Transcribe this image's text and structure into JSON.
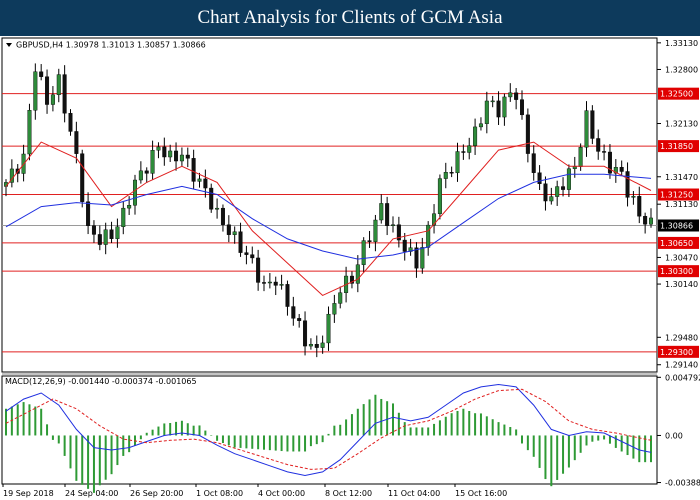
{
  "banner": {
    "title": "Chart Analysis for Clients of GCM Asia"
  },
  "chart_data": [
    {
      "type": "candlestick",
      "title": "GBPUSD,H4  1.30978 1.31013 1.30857 1.30866",
      "symbol": "GBPUSD",
      "timeframe": "H4",
      "quote": {
        "open": 1.30978,
        "high": 1.31013,
        "low": 1.30857,
        "close": 1.30866
      },
      "price_axis": {
        "ylim": [
          1.2905,
          1.3319
        ],
        "tick_labels": [
          "1.33130",
          "1.32800",
          "1.32130",
          "1.31470",
          "1.31130",
          "1.30470",
          "1.30140",
          "1.29480",
          "1.29140"
        ],
        "tick_values": [
          1.3313,
          1.328,
          1.3213,
          1.3147,
          1.3113,
          1.3047,
          1.3014,
          1.2948,
          1.2914
        ]
      },
      "support_resistance": [
        {
          "label": "1.32500",
          "value": 1.325
        },
        {
          "label": "1.31850",
          "value": 1.3185
        },
        {
          "label": "1.31250",
          "value": 1.3125
        },
        {
          "label": "1.30650",
          "value": 1.3065
        },
        {
          "label": "1.30300",
          "value": 1.303
        },
        {
          "label": "1.29300",
          "value": 1.293
        }
      ],
      "current_price": {
        "label": "1.30866",
        "value": 1.30866
      },
      "x_tick_labels": [
        "19 Sep 2018",
        "24 Sep 04:00",
        "26 Sep 20:00",
        "1 Oct 08:00",
        "4 Oct 00:00",
        "8 Oct 12:00",
        "11 Oct 04:00",
        "15 Oct 16:00"
      ],
      "close_path": [
        [
          0,
          1.314
        ],
        [
          3,
          1.317
        ],
        [
          5,
          1.3285
        ],
        [
          7,
          1.324
        ],
        [
          9,
          1.3265
        ],
        [
          12,
          1.317
        ],
        [
          14,
          1.308
        ],
        [
          16,
          1.307
        ],
        [
          18,
          1.3075
        ],
        [
          20,
          1.31
        ],
        [
          22,
          1.314
        ],
        [
          24,
          1.316
        ],
        [
          26,
          1.3185
        ],
        [
          28,
          1.317
        ],
        [
          30,
          1.3175
        ],
        [
          32,
          1.315
        ],
        [
          34,
          1.313
        ],
        [
          36,
          1.31
        ],
        [
          38,
          1.308
        ],
        [
          40,
          1.306
        ],
        [
          42,
          1.304
        ],
        [
          44,
          1.301
        ],
        [
          46,
          1.302
        ],
        [
          48,
          1.299
        ],
        [
          50,
          1.296
        ],
        [
          51,
          1.2945
        ],
        [
          53,
          1.293
        ],
        [
          55,
          1.297
        ],
        [
          57,
          1.301
        ],
        [
          59,
          1.302
        ],
        [
          61,
          1.306
        ],
        [
          63,
          1.309
        ],
        [
          64,
          1.311
        ],
        [
          66,
          1.308
        ],
        [
          68,
          1.306
        ],
        [
          70,
          1.304
        ],
        [
          72,
          1.308
        ],
        [
          74,
          1.314
        ],
        [
          76,
          1.316
        ],
        [
          78,
          1.318
        ],
        [
          80,
          1.32
        ],
        [
          82,
          1.324
        ],
        [
          84,
          1.323
        ],
        [
          86,
          1.325
        ],
        [
          87,
          1.325
        ],
        [
          89,
          1.318
        ],
        [
          91,
          1.313
        ],
        [
          93,
          1.312
        ],
        [
          95,
          1.314
        ],
        [
          97,
          1.316
        ],
        [
          99,
          1.322
        ],
        [
          101,
          1.318
        ],
        [
          103,
          1.316
        ],
        [
          105,
          1.315
        ],
        [
          106,
          1.313
        ],
        [
          108,
          1.31
        ],
        [
          110,
          1.3087
        ]
      ],
      "ma_fast": [
        [
          0,
          1.3135
        ],
        [
          6,
          1.319
        ],
        [
          12,
          1.317
        ],
        [
          18,
          1.311
        ],
        [
          24,
          1.314
        ],
        [
          30,
          1.316
        ],
        [
          36,
          1.314
        ],
        [
          42,
          1.308
        ],
        [
          48,
          1.304
        ],
        [
          54,
          1.3
        ],
        [
          60,
          1.302
        ],
        [
          66,
          1.307
        ],
        [
          72,
          1.308
        ],
        [
          78,
          1.313
        ],
        [
          84,
          1.318
        ],
        [
          90,
          1.319
        ],
        [
          96,
          1.316
        ],
        [
          102,
          1.316
        ],
        [
          110,
          1.313
        ]
      ],
      "ma_slow": [
        [
          0,
          1.3085
        ],
        [
          6,
          1.311
        ],
        [
          12,
          1.3115
        ],
        [
          18,
          1.3112
        ],
        [
          24,
          1.3125
        ],
        [
          30,
          1.3135
        ],
        [
          36,
          1.3125
        ],
        [
          42,
          1.3095
        ],
        [
          48,
          1.307
        ],
        [
          54,
          1.3055
        ],
        [
          60,
          1.3045
        ],
        [
          66,
          1.305
        ],
        [
          72,
          1.306
        ],
        [
          78,
          1.309
        ],
        [
          84,
          1.312
        ],
        [
          90,
          1.314
        ],
        [
          96,
          1.315
        ],
        [
          102,
          1.315
        ],
        [
          110,
          1.3145
        ]
      ]
    },
    {
      "type": "line",
      "title": "MACD(12,26,9) -0.001440 -0.000374 -0.001065",
      "indicator": "MACD(12,26,9)",
      "readout": {
        "main": -0.00144,
        "signal": -0.000374,
        "histogram": -0.001065
      },
      "ylim": [
        -0.004,
        0.0049
      ],
      "tick_labels": [
        "0.004792",
        "0.00",
        "-0.00388"
      ],
      "tick_values": [
        0.004792,
        0.0,
        -0.00388
      ],
      "main_line": [
        [
          0,
          0.002
        ],
        [
          3,
          0.003
        ],
        [
          6,
          0.0035
        ],
        [
          9,
          0.0025
        ],
        [
          12,
          0.0005
        ],
        [
          15,
          -0.001
        ],
        [
          18,
          -0.0012
        ],
        [
          21,
          -0.001
        ],
        [
          24,
          -0.0005
        ],
        [
          27,
          0.0
        ],
        [
          30,
          0.0002
        ],
        [
          33,
          0.0
        ],
        [
          36,
          -0.0008
        ],
        [
          39,
          -0.0015
        ],
        [
          42,
          -0.002
        ],
        [
          45,
          -0.0025
        ],
        [
          48,
          -0.003
        ],
        [
          51,
          -0.0033
        ],
        [
          54,
          -0.003
        ],
        [
          57,
          -0.002
        ],
        [
          60,
          -0.0005
        ],
        [
          63,
          0.001
        ],
        [
          66,
          0.0015
        ],
        [
          69,
          0.0012
        ],
        [
          72,
          0.0015
        ],
        [
          75,
          0.0025
        ],
        [
          78,
          0.0035
        ],
        [
          81,
          0.004
        ],
        [
          84,
          0.0042
        ],
        [
          87,
          0.004
        ],
        [
          90,
          0.0025
        ],
        [
          93,
          0.0005
        ],
        [
          96,
          0.0
        ],
        [
          99,
          0.0003
        ],
        [
          102,
          0.0002
        ],
        [
          105,
          -0.0005
        ],
        [
          108,
          -0.0012
        ],
        [
          110,
          -0.0014
        ]
      ],
      "signal_line": [
        [
          0,
          0.001
        ],
        [
          4,
          0.002
        ],
        [
          8,
          0.003
        ],
        [
          12,
          0.0022
        ],
        [
          16,
          0.0008
        ],
        [
          20,
          -0.0003
        ],
        [
          24,
          -0.0006
        ],
        [
          28,
          -0.0004
        ],
        [
          32,
          -0.0003
        ],
        [
          36,
          -0.0006
        ],
        [
          40,
          -0.0012
        ],
        [
          44,
          -0.0018
        ],
        [
          48,
          -0.0024
        ],
        [
          52,
          -0.0028
        ],
        [
          56,
          -0.0027
        ],
        [
          60,
          -0.0015
        ],
        [
          64,
          -0.0002
        ],
        [
          68,
          0.0008
        ],
        [
          72,
          0.0012
        ],
        [
          76,
          0.002
        ],
        [
          80,
          0.003
        ],
        [
          84,
          0.0037
        ],
        [
          88,
          0.0038
        ],
        [
          92,
          0.0028
        ],
        [
          96,
          0.0012
        ],
        [
          100,
          0.0005
        ],
        [
          104,
          0.0002
        ],
        [
          108,
          -0.0002
        ],
        [
          110,
          -0.0004
        ]
      ]
    }
  ]
}
